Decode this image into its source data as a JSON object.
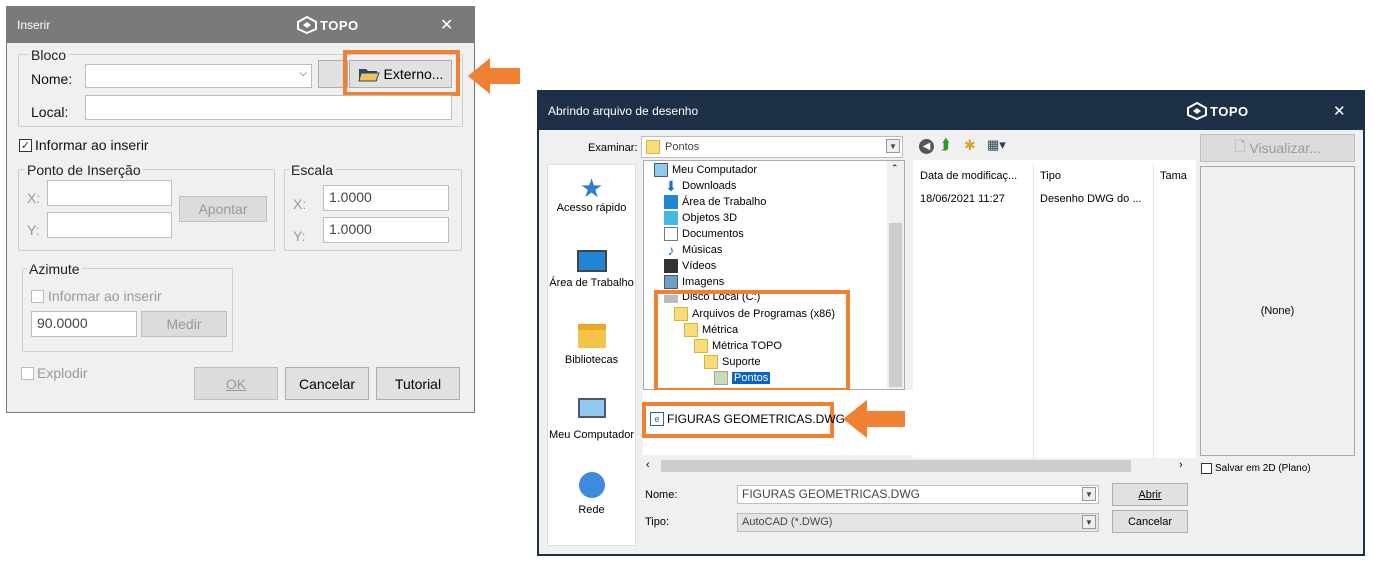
{
  "insert_dialog": {
    "title": "Inserir",
    "logo_text": "TOPO",
    "bloco": {
      "group_label": "Bloco",
      "nome_label": "Nome:",
      "nome_value": "",
      "local_label": "Local:",
      "local_value": "",
      "externo_button": "Externo..."
    },
    "informar_checkbox": {
      "label": "Informar ao inserir",
      "checked": true
    },
    "ponto": {
      "group_label": "Ponto de Inserção",
      "x_label": "X:",
      "y_label": "Y:",
      "x_value": "",
      "y_value": "",
      "apontar_button": "Apontar"
    },
    "escala": {
      "group_label": "Escala",
      "x_label": "X:",
      "y_label": "Y:",
      "x_value": "1.0000",
      "y_value": "1.0000"
    },
    "azimute": {
      "group_label": "Azimute",
      "informar_label": "Informar ao inserir",
      "value": "90.0000",
      "medir_button": "Medir"
    },
    "explodir_label": "Explodir",
    "buttons": {
      "ok": "OK",
      "cancelar": "Cancelar",
      "tutorial": "Tutorial"
    }
  },
  "open_dialog": {
    "title": "Abrindo arquivo de desenho",
    "logo_text": "TOPO",
    "examinar_label": "Examinar:",
    "examinar_value": "Pontos",
    "visualizar_button": "Visualizar...",
    "places": [
      {
        "label": "Acesso rápido",
        "icon": "star-icon"
      },
      {
        "label": "Área de Trabalho",
        "icon": "desktop-icon"
      },
      {
        "label": "Bibliotecas",
        "icon": "libraries-icon"
      },
      {
        "label": "Meu Computador",
        "icon": "computer-icon"
      },
      {
        "label": "Rede",
        "icon": "network-icon"
      }
    ],
    "tree": [
      {
        "label": "Meu Computador",
        "icon": "computer-icon"
      },
      {
        "label": "Downloads",
        "icon": "download-icon"
      },
      {
        "label": "Área de Trabalho",
        "icon": "desktop-icon"
      },
      {
        "label": "Objetos 3D",
        "icon": "cube-icon"
      },
      {
        "label": "Documentos",
        "icon": "document-icon"
      },
      {
        "label": "Músicas",
        "icon": "music-icon"
      },
      {
        "label": "Vídeos",
        "icon": "video-icon"
      },
      {
        "label": "Imagens",
        "icon": "image-icon"
      },
      {
        "label": "Disco Local (C:)",
        "icon": "drive-icon"
      },
      {
        "label": "Arquivos de Programas (x86)",
        "icon": "folder-icon"
      },
      {
        "label": "Métrica",
        "icon": "folder-icon"
      },
      {
        "label": "Métrica TOPO",
        "icon": "folder-icon"
      },
      {
        "label": "Suporte",
        "icon": "folder-icon"
      },
      {
        "label": "Pontos",
        "icon": "folder-icon"
      }
    ],
    "file_item": "FIGURAS GEOMETRICAS.DWG",
    "columns": [
      "Data de modificaç...",
      "Tipo",
      "Tama"
    ],
    "row": {
      "date": "18/06/2021 11:27",
      "type": "Desenho DWG do ..."
    },
    "preview_text": "(None)",
    "salvar_2d_label": "Salvar em 2D (Plano)",
    "nome_label": "Nome:",
    "nome_value": "FIGURAS GEOMETRICAS.DWG",
    "tipo_label": "Tipo:",
    "tipo_value": "AutoCAD (*.DWG)",
    "abrir_button": "Abrir",
    "cancelar_button": "Cancelar"
  },
  "colors": {
    "accent_orange": "#f08032",
    "titlebar_gray": "#7a7a7a",
    "titlebar_navy": "#1d3047"
  }
}
